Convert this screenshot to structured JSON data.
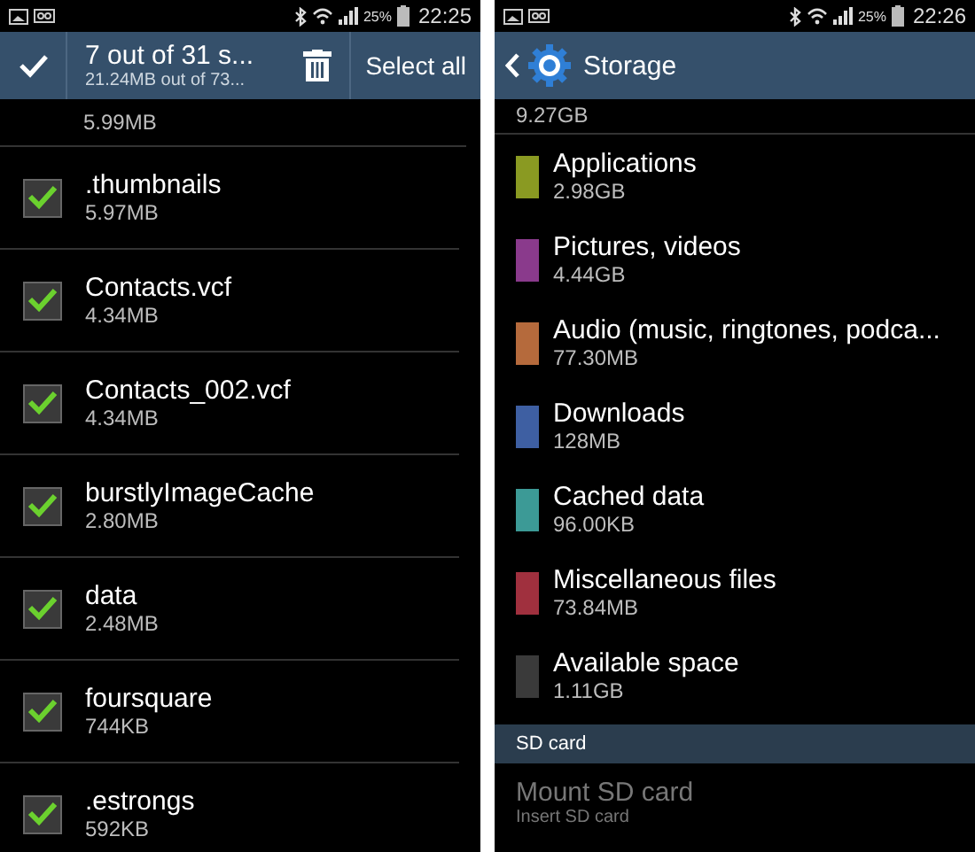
{
  "screens": [
    {
      "status_bar": {
        "battery": "25%",
        "time": "22:25"
      },
      "action_bar": {
        "title": "7 out of 31 s...",
        "subtitle": "21.24MB out of 73...",
        "select_all": "Select all"
      },
      "partial_item": {
        "size": "5.99MB"
      },
      "files": [
        {
          "name": ".thumbnails",
          "size": "5.97MB",
          "checked": true
        },
        {
          "name": "Contacts.vcf",
          "size": "4.34MB",
          "checked": true
        },
        {
          "name": "Contacts_002.vcf",
          "size": "4.34MB",
          "checked": true
        },
        {
          "name": "burstlyImageCache",
          "size": "2.80MB",
          "checked": true
        },
        {
          "name": "data",
          "size": "2.48MB",
          "checked": true
        },
        {
          "name": "foursquare",
          "size": "744KB",
          "checked": true
        },
        {
          "name": ".estrongs",
          "size": "592KB",
          "checked": true
        }
      ]
    },
    {
      "status_bar": {
        "battery": "25%",
        "time": "22:26"
      },
      "action_bar": {
        "title": "Storage"
      },
      "partial_item": {
        "size": "9.27GB"
      },
      "storage": [
        {
          "name": "Applications",
          "size": "2.98GB",
          "color": "#8a9a22"
        },
        {
          "name": "Pictures, videos",
          "size": "4.44GB",
          "color": "#8a3a8c"
        },
        {
          "name": "Audio (music, ringtones, podca...",
          "size": "77.30MB",
          "color": "#b56a3c"
        },
        {
          "name": "Downloads",
          "size": "128MB",
          "color": "#3e5fa2"
        },
        {
          "name": "Cached data",
          "size": "96.00KB",
          "color": "#3c9a96"
        },
        {
          "name": "Miscellaneous files",
          "size": "73.84MB",
          "color": "#a0303e"
        },
        {
          "name": "Available space",
          "size": "1.11GB",
          "color": "#3a3a3a"
        }
      ],
      "section_header": "SD card",
      "mount": {
        "title": "Mount SD card",
        "subtitle": "Insert SD card",
        "disabled": true
      }
    }
  ]
}
